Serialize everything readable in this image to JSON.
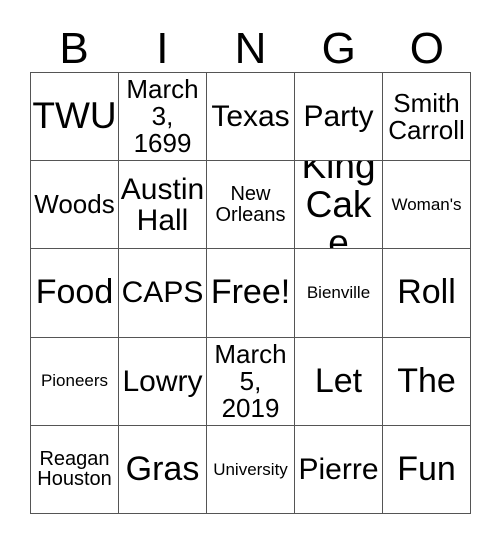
{
  "card": {
    "header_letters": [
      "B",
      "I",
      "N",
      "G",
      "O"
    ],
    "background_color": "#ffffff",
    "border_color": "#555555",
    "text_color": "#000000",
    "rows": [
      [
        {
          "text": "TWU",
          "size": "xxl"
        },
        {
          "text": "March 3, 1699",
          "size": "md"
        },
        {
          "text": "Texas",
          "size": "lg"
        },
        {
          "text": "Party",
          "size": "lg"
        },
        {
          "text": "Smith Carroll",
          "size": "md"
        }
      ],
      [
        {
          "text": "Woods",
          "size": "md"
        },
        {
          "text": "Austin Hall",
          "size": "lg"
        },
        {
          "text": "New Orleans",
          "size": "sm"
        },
        {
          "text": "King Cake",
          "size": "xxl"
        },
        {
          "text": "Woman's",
          "size": "xs"
        }
      ],
      [
        {
          "text": "Food",
          "size": "xl"
        },
        {
          "text": "CAPS",
          "size": "lg"
        },
        {
          "text": "Free!",
          "size": "xl"
        },
        {
          "text": "Bienville",
          "size": "xs"
        },
        {
          "text": "Roll",
          "size": "xl"
        }
      ],
      [
        {
          "text": "Pioneers",
          "size": "xs"
        },
        {
          "text": "Lowry",
          "size": "lg"
        },
        {
          "text": "March 5, 2019",
          "size": "md"
        },
        {
          "text": "Let",
          "size": "xl"
        },
        {
          "text": "The",
          "size": "xl"
        }
      ],
      [
        {
          "text": "Reagan Houston",
          "size": "sm"
        },
        {
          "text": "Gras",
          "size": "xl"
        },
        {
          "text": "University",
          "size": "xs"
        },
        {
          "text": "Pierre",
          "size": "lg"
        },
        {
          "text": "Fun",
          "size": "xl"
        }
      ]
    ]
  }
}
